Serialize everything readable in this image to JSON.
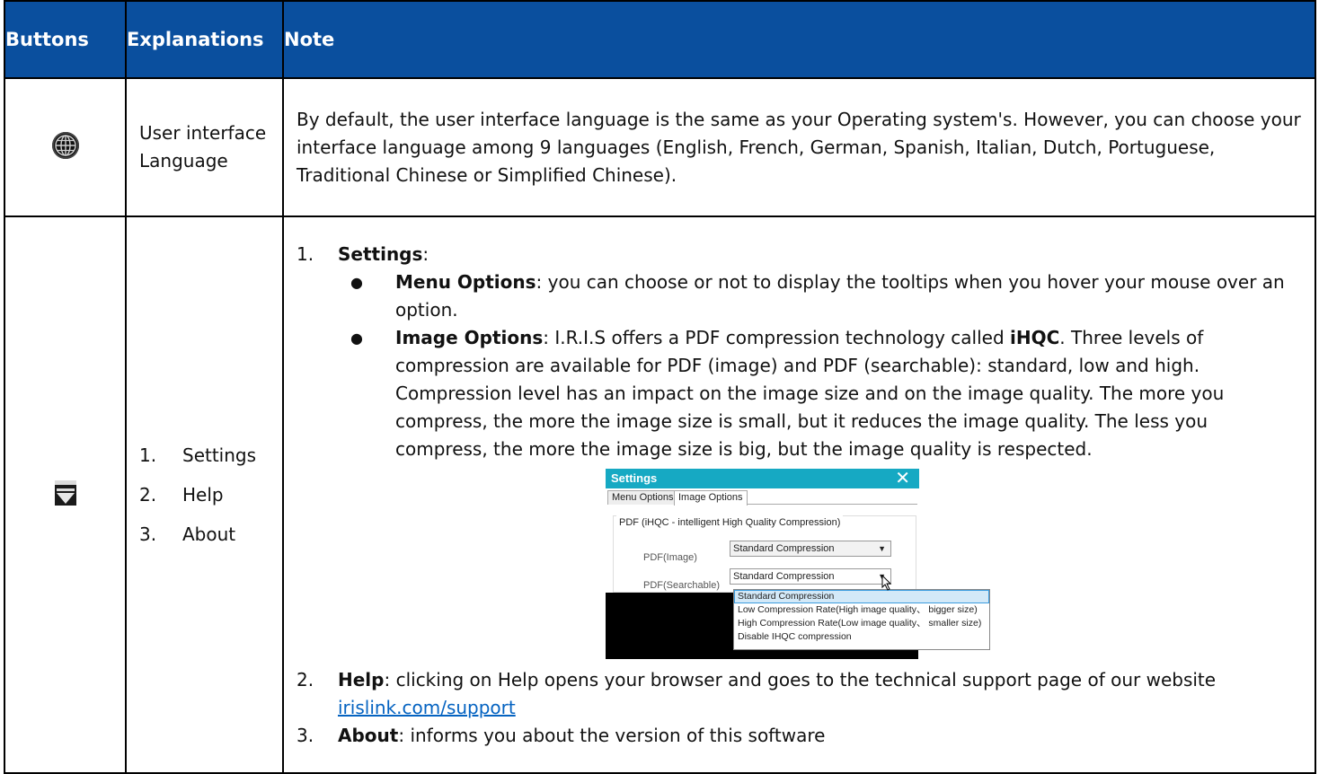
{
  "table": {
    "headers": [
      "Buttons",
      "Explanations",
      "Note"
    ],
    "row1": {
      "icon": "globe-icon",
      "explanation": "User interface Language",
      "note": "By default, the user interface language is the same as your Operating system's. However, you can choose your interface language among 9 languages (English, French, German, Spanish, Italian, Dutch, Portuguese, Traditional Chinese or Simplified Chinese)."
    },
    "row2": {
      "icon": "dropdown-menu-icon",
      "explanation_items": [
        {
          "num": "1.",
          "label": "Settings"
        },
        {
          "num": "2.",
          "label": "Help"
        },
        {
          "num": "3.",
          "label": "About"
        }
      ],
      "note": {
        "item1_num": "1.",
        "item1_title": "Settings",
        "item1_suffix": ":",
        "bullet1_title": "Menu Options",
        "bullet1_text": ": you can choose or not to display the tooltips when you hover your mouse over an option.",
        "bullet2_title": "Image Options",
        "bullet2_text_a": ": I.R.I.S offers a PDF compression technology called ",
        "bullet2_bold": "iHQC",
        "bullet2_text_b": ". Three levels of compression are available for PDF (image) and PDF (searchable): standard, low and high. Compression level has an impact on the image size and on the image quality. The more you compress, the more the image size is small, but it reduces the image quality. The less you compress, the more the image size is big, but the image quality is respected.",
        "item2_num": "2.",
        "item2_title": "Help",
        "item2_text": ": clicking on Help opens your browser and goes to the technical support page of our website ",
        "item2_link": "irislink.com/support",
        "item3_num": "3.",
        "item3_title": "About",
        "item3_text": ": informs you about the version of this software"
      }
    }
  },
  "dialog": {
    "title": "Settings",
    "close": "✕",
    "tabs": [
      "Menu Options",
      "Image Options"
    ],
    "group_label": "PDF (iHQC - intelligent High Quality Compression)",
    "fields": [
      {
        "label": "PDF(Image)",
        "value": "Standard Compression"
      },
      {
        "label": "PDF(Searchable)",
        "value": "Standard Compression"
      }
    ],
    "dropdown_options": [
      "Standard Compression",
      "Low Compression Rate(High image quality、 bigger size)",
      "High Compression Rate(Low image quality、 smaller size)",
      "Disable IHQC compression"
    ],
    "colors": {
      "titlebar": "#16a9c3",
      "header": "#0a4f9e",
      "link": "#0563c1"
    }
  }
}
